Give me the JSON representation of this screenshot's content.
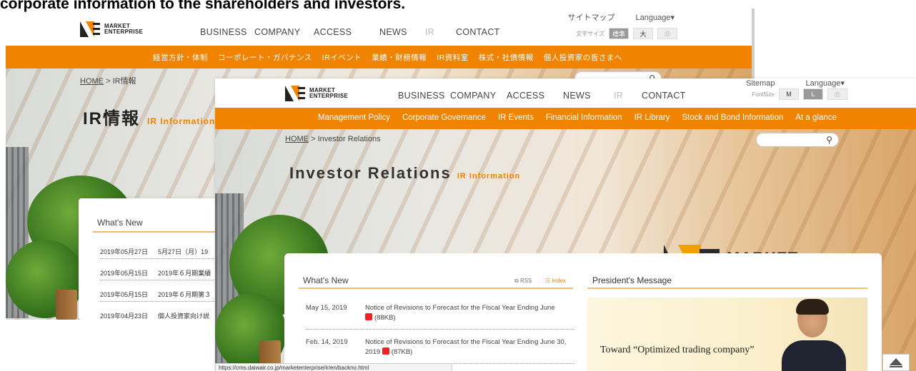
{
  "caption": "corporate information to the shareholders and investors.",
  "brand": {
    "logo_line1": "MARKET",
    "logo_line2": "ENTERPRISE",
    "accent_color": "#f08300"
  },
  "jp": {
    "util": {
      "sitemap": "サイトマップ",
      "language": "Language▾"
    },
    "fontsize": {
      "label": "文字サイズ",
      "std": "標準",
      "large": "大"
    },
    "nav": [
      "BUSINESS",
      "COMPANY",
      "ACCESS",
      "NEWS",
      "IR",
      "CONTACT"
    ],
    "subnav": [
      "経営方針・体制",
      "コーポレート・ガバナンス",
      "IRイベント",
      "業績・財務情報",
      "IR資料室",
      "株式・社債情報",
      "個人投資家の皆さまへ"
    ],
    "breadcrumb": {
      "home": "HOME",
      "sep": ">",
      "current": "IR情報"
    },
    "title": "IR情報",
    "title_sub": "IR Information",
    "news_heading": "What's New",
    "news": [
      {
        "date": "2019年05月27日",
        "text": "5月27日（月）19"
      },
      {
        "date": "2019年05月15日",
        "text": "2019年６月期業績"
      },
      {
        "date": "2019年05月15日",
        "text": "2019年６月期第３"
      },
      {
        "date": "2019年04月23日",
        "text": "個人投資家向け説"
      }
    ]
  },
  "en": {
    "util": {
      "sitemap": "Sitemap",
      "language": "Language▾"
    },
    "fontsize": {
      "label": "FontSize",
      "m": "M",
      "l": "L"
    },
    "nav": [
      "BUSINESS",
      "COMPANY",
      "ACCESS",
      "NEWS",
      "IR",
      "CONTACT"
    ],
    "subnav": [
      "Management Policy",
      "Corporate Governance",
      "IR Events",
      "Financial Information",
      "IR Library",
      "Stock and Bond Information",
      "At a glance"
    ],
    "breadcrumb": {
      "home": "HOME",
      "sep": ">",
      "current": "Investor Relations"
    },
    "title": "Investor Relations",
    "title_sub": "IR Information",
    "search_icon": "magnifier-icon",
    "news_heading": "What's New",
    "rss_label": "RSS",
    "index_label": "Index",
    "news": [
      {
        "date": "May 15, 2019",
        "text": "Notice of Revisions to Forecast for the Fiscal Year Ending June",
        "size": "(88KB)"
      },
      {
        "date": "Feb. 14, 2019",
        "text": "Notice of Revisions to Forecast for the Fiscal Year Ending June 30, 2019",
        "size": "(87KB)"
      }
    ],
    "president_heading": "President's Message",
    "president_message": "Toward “Optimized trading company”"
  },
  "status_url": "https://cms.daiwair.co.jp/marketenterprise/ir/en/backno.html"
}
